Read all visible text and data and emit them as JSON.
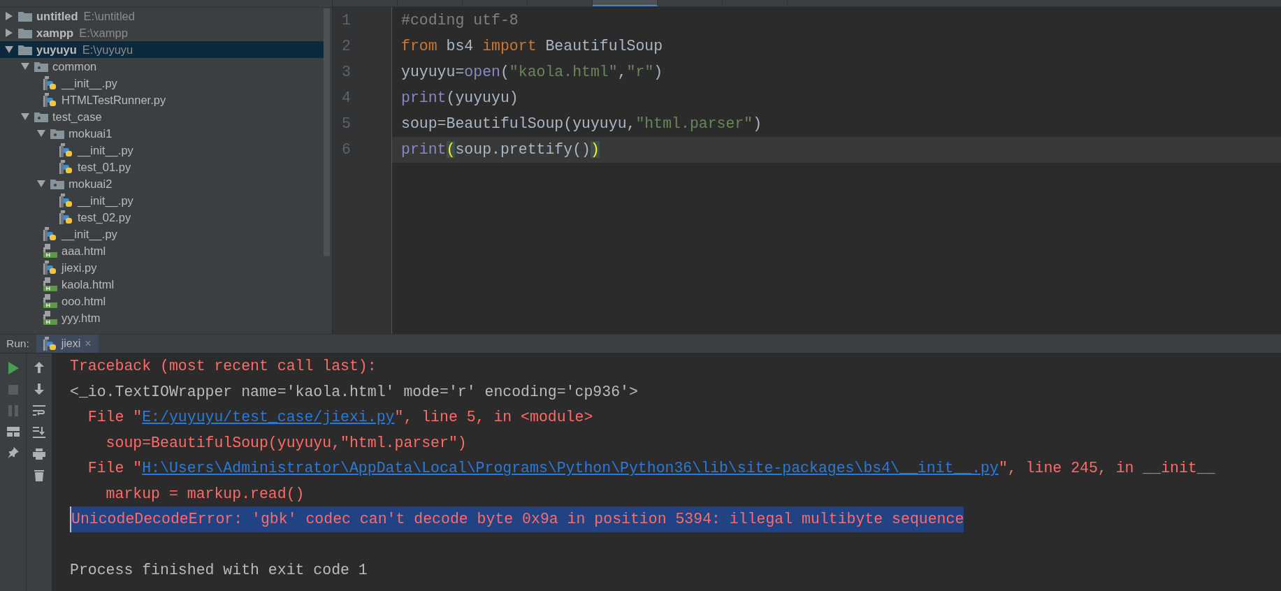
{
  "project_tree": [
    {
      "name": "untitled",
      "path": "E:\\untitled",
      "kind": "folder",
      "expanded": false,
      "selected": false
    },
    {
      "name": "xampp",
      "path": "E:\\xampp",
      "kind": "folder",
      "expanded": false,
      "selected": false
    },
    {
      "name": "yuyuyu",
      "path": "E:\\yuyuyu",
      "kind": "folder",
      "expanded": true,
      "selected": true,
      "children": [
        {
          "name": "common",
          "kind": "package",
          "expanded": true,
          "selected": false,
          "children": [
            {
              "name": "__init__.py",
              "kind": "python",
              "selected": false
            },
            {
              "name": "HTMLTestRunner.py",
              "kind": "python",
              "selected": false
            }
          ]
        },
        {
          "name": "test_case",
          "kind": "package",
          "expanded": true,
          "selected": false,
          "children": [
            {
              "name": "mokuai1",
              "kind": "package",
              "expanded": true,
              "selected": false,
              "children": [
                {
                  "name": "__init__.py",
                  "kind": "python",
                  "selected": false
                },
                {
                  "name": "test_01.py",
                  "kind": "python",
                  "selected": false
                }
              ]
            },
            {
              "name": "mokuai2",
              "kind": "package",
              "expanded": true,
              "selected": false,
              "children": [
                {
                  "name": "__init__.py",
                  "kind": "python",
                  "selected": false
                },
                {
                  "name": "test_02.py",
                  "kind": "python",
                  "selected": false
                }
              ]
            },
            {
              "name": "__init__.py",
              "kind": "python",
              "selected": false
            },
            {
              "name": "aaa.html",
              "kind": "html",
              "selected": false
            },
            {
              "name": "jiexi.py",
              "kind": "python",
              "selected": false
            },
            {
              "name": "kaola.html",
              "kind": "html",
              "selected": false
            },
            {
              "name": "ooo.html",
              "kind": "html",
              "selected": false
            },
            {
              "name": "yyy.htm",
              "kind": "html",
              "selected": false
            }
          ]
        }
      ]
    }
  ],
  "editor": {
    "tabs": [
      {
        "selected": false
      },
      {
        "selected": false
      },
      {
        "selected": false
      },
      {
        "selected": false
      },
      {
        "selected": true
      },
      {
        "selected": false
      },
      {
        "selected": false
      }
    ],
    "lines": [
      {
        "number": "1",
        "current": false,
        "tokens": [
          {
            "text": "#coding utf-8",
            "kind": "comment"
          }
        ]
      },
      {
        "number": "2",
        "current": false,
        "tokens": [
          {
            "text": "from",
            "kind": "keyword"
          },
          {
            "text": " bs4 ",
            "kind": "plain"
          },
          {
            "text": "import",
            "kind": "keyword"
          },
          {
            "text": " BeautifulSoup",
            "kind": "plain"
          }
        ]
      },
      {
        "number": "3",
        "current": false,
        "tokens": [
          {
            "text": "yuyuyu=",
            "kind": "plain"
          },
          {
            "text": "open",
            "kind": "builtin"
          },
          {
            "text": "(",
            "kind": "plain"
          },
          {
            "text": "\"kaola.html\"",
            "kind": "string"
          },
          {
            "text": ",",
            "kind": "plain"
          },
          {
            "text": "\"r\"",
            "kind": "string"
          },
          {
            "text": ")",
            "kind": "plain"
          }
        ]
      },
      {
        "number": "4",
        "current": false,
        "tokens": [
          {
            "text": "print",
            "kind": "builtin"
          },
          {
            "text": "(yuyuyu)",
            "kind": "plain"
          }
        ]
      },
      {
        "number": "5",
        "current": false,
        "tokens": [
          {
            "text": "soup=BeautifulSoup(yuyuyu,",
            "kind": "plain"
          },
          {
            "text": "\"html.parser\"",
            "kind": "string"
          },
          {
            "text": ")",
            "kind": "plain"
          }
        ]
      },
      {
        "number": "6",
        "current": true,
        "tokens": [
          {
            "text": "print",
            "kind": "builtin"
          },
          {
            "text": "(",
            "kind": "brace"
          },
          {
            "text": "soup.prettify()",
            "kind": "plain"
          },
          {
            "text": ")",
            "kind": "brace"
          }
        ]
      }
    ]
  },
  "run_panel": {
    "label": "Run:",
    "tabs": [
      {
        "title": "jiexi",
        "close": "×",
        "selected": true
      }
    ],
    "output": [
      {
        "selected": false,
        "segments": [
          {
            "text": "Traceback (most recent call last):",
            "kind": "error"
          }
        ]
      },
      {
        "selected": false,
        "segments": [
          {
            "text": "<_io.TextIOWrapper name='kaola.html' mode='r' encoding='cp936'>",
            "kind": "normal"
          }
        ]
      },
      {
        "selected": false,
        "segments": [
          {
            "text": "  File \"",
            "kind": "error"
          },
          {
            "text": "E:/yuyuyu/test_case/jiexi.py",
            "kind": "link"
          },
          {
            "text": "\", line 5, in <module>",
            "kind": "error"
          }
        ]
      },
      {
        "selected": false,
        "segments": [
          {
            "text": "    soup=BeautifulSoup(yuyuyu,\"html.parser\")",
            "kind": "error"
          }
        ]
      },
      {
        "selected": false,
        "segments": [
          {
            "text": "  File \"",
            "kind": "error"
          },
          {
            "text": "H:\\Users\\Administrator\\AppData\\Local\\Programs\\Python\\Python36\\lib\\site-packages\\bs4\\__init__.py",
            "kind": "link"
          },
          {
            "text": "\", line 245, in __init__",
            "kind": "error"
          }
        ]
      },
      {
        "selected": false,
        "segments": [
          {
            "text": "    markup = markup.read()",
            "kind": "error"
          }
        ]
      },
      {
        "selected": true,
        "segments": [
          {
            "text": "UnicodeDecodeError: 'gbk' codec can't decode byte 0x9a in position 5394: illegal multibyte sequence",
            "kind": "error"
          }
        ]
      },
      {
        "selected": false,
        "segments": [
          {
            "text": "Process finished with exit code 1",
            "kind": "normal"
          }
        ]
      }
    ]
  }
}
